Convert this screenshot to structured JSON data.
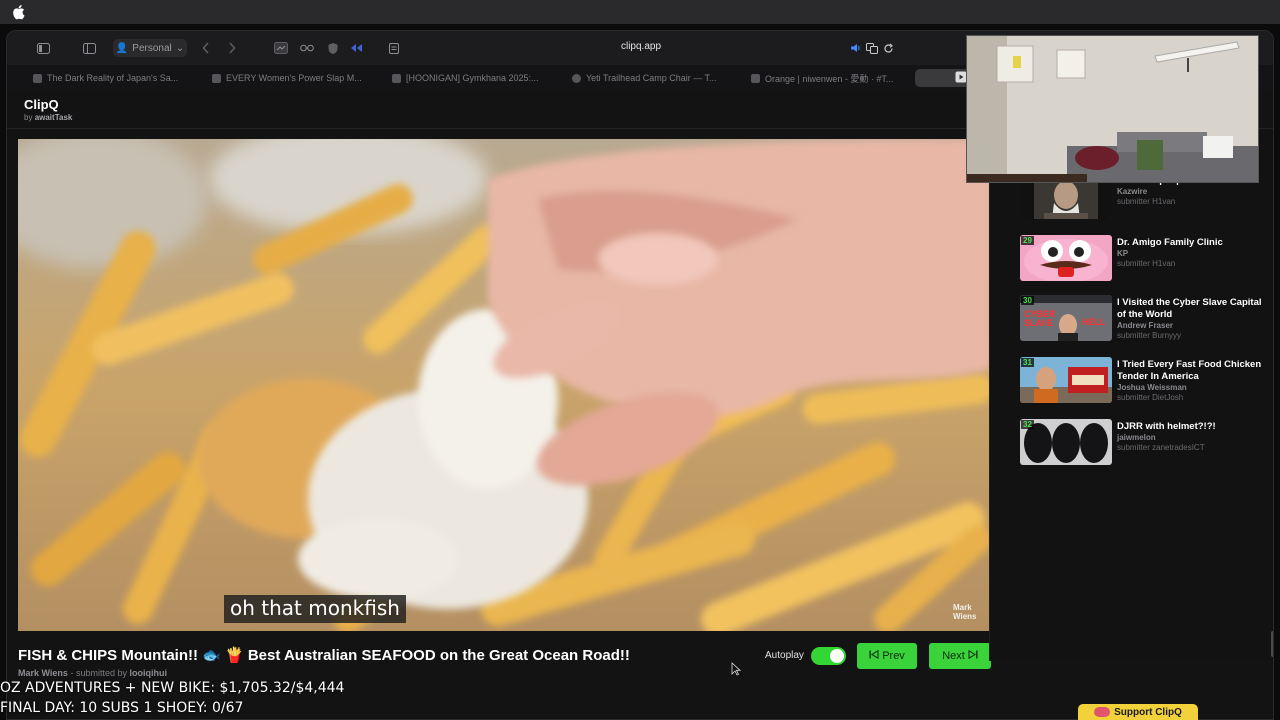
{
  "browser": {
    "profile_label": "Personal",
    "url": "clipq.app",
    "tabs": [
      {
        "label": "The Dark Reality of Japan's Sa..."
      },
      {
        "label": "EVERY Women's Power Slap M..."
      },
      {
        "label": "[HOONIGAN] Gymkhana 2025:..."
      },
      {
        "label": "Yeti Trailhead Camp Chair — T..."
      },
      {
        "label": "Orange | niwenwen - 愛動 · #T..."
      }
    ]
  },
  "app": {
    "name": "ClipQ",
    "by_prefix": "by",
    "by_author": "awaitTask"
  },
  "video": {
    "caption": "oh that monkfish",
    "watermark_line1": "Mark",
    "watermark_line2": "Wiens",
    "title": "FISH & CHIPS Mountain!! 🐟 🍟 Best Australian SEAFOOD on the Great Ocean Road!!",
    "channel": "Mark Wiens",
    "submitted_prefix": "- submitted by",
    "submitter": "looiqihui"
  },
  "controls": {
    "autoplay_label": "Autoplay",
    "autoplay_on": true,
    "prev_label": "Prev",
    "next_label": "Next"
  },
  "queue": [
    {
      "num": "",
      "title": "...but the people are",
      "channel": "Kazwire",
      "submitter": "submitter H1van"
    },
    {
      "num": "29",
      "title": "Dr. Amigo Family Clinic",
      "channel": "KP",
      "submitter": "submitter H1van"
    },
    {
      "num": "30",
      "title": "I Visited the Cyber Slave Capital of the World",
      "channel": "Andrew Fraser",
      "submitter": "submitter Burnyyy"
    },
    {
      "num": "31",
      "title": "I Tried Every Fast Food Chicken Tender In America",
      "channel": "Joshua Weissman",
      "submitter": "submitter DietJosh"
    },
    {
      "num": "32",
      "title": "DJRR with helmet?!?!",
      "channel": "jaiwmelon",
      "submitter": "submitter zanetradesICT"
    }
  ],
  "thumb_texts": {
    "q30_line1": "CYBER",
    "q30_line2": "SLAVE",
    "q30_line3": "HELL"
  },
  "stream_overlay": {
    "goal_line": "OZ ADVENTURES + NEW BIKE: $1,705.32/$4,444",
    "final_line": "FINAL DAY: 10 SUBS 1 SHOEY: 0/67",
    "support_label": "Support ClipQ"
  },
  "colors": {
    "accent_green": "#3ad33a",
    "queue_number": "#4ee04e",
    "support_yellow": "#f2d23a"
  }
}
